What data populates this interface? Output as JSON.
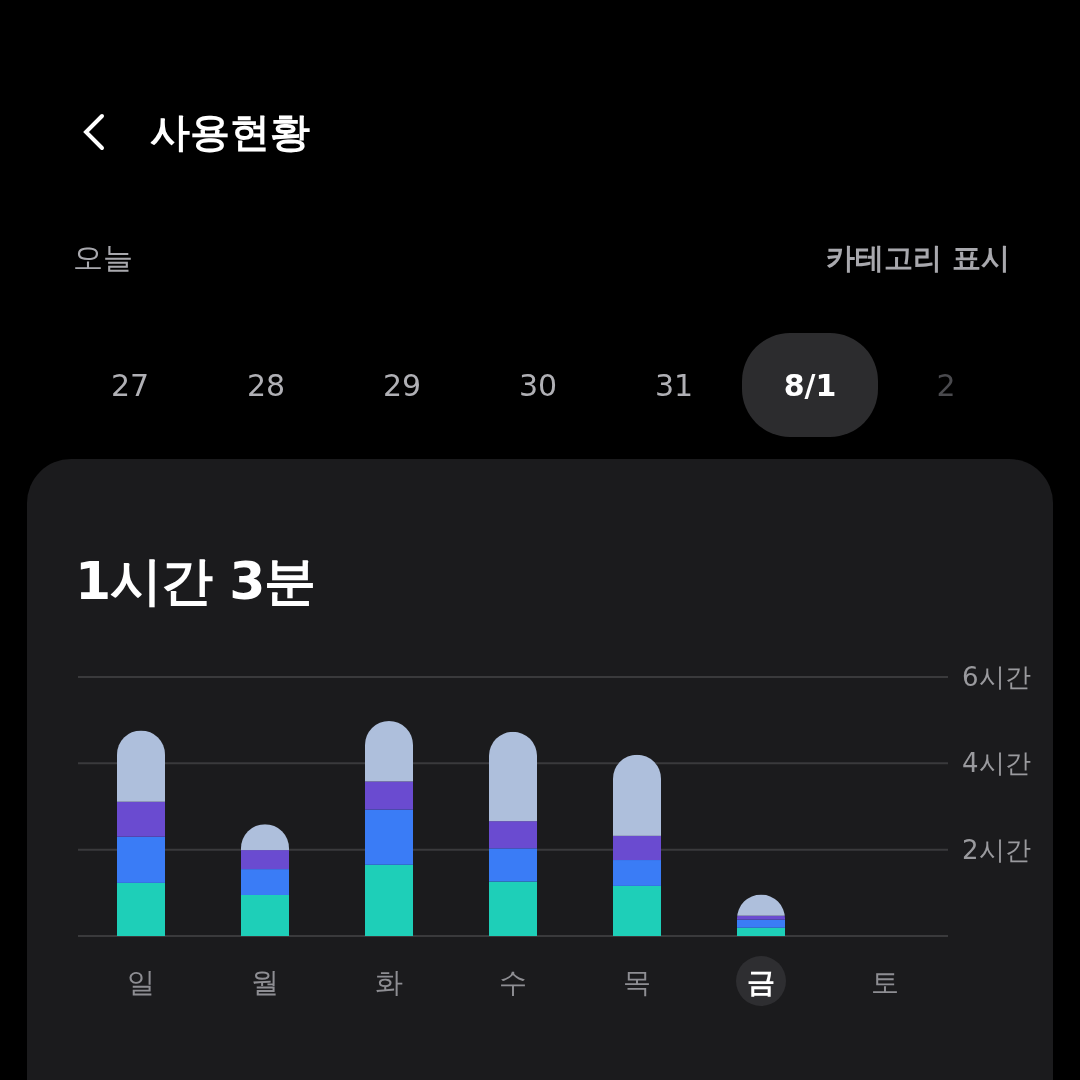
{
  "header": {
    "title": "사용현황"
  },
  "filter_row": {
    "period": "오늘",
    "category_toggle": "카테고리 표시"
  },
  "dates": [
    {
      "label": "27",
      "selected": false
    },
    {
      "label": "28",
      "selected": false
    },
    {
      "label": "29",
      "selected": false
    },
    {
      "label": "30",
      "selected": false
    },
    {
      "label": "31",
      "selected": false
    },
    {
      "label": "8/1",
      "selected": true
    },
    {
      "label": "2",
      "selected": false
    }
  ],
  "usage_card": {
    "total": "1시간 3분",
    "weekday_selected": [
      false,
      false,
      false,
      false,
      false,
      true,
      false
    ],
    "chart_data": {
      "type": "bar",
      "stacked": true,
      "categories": [
        "일",
        "월",
        "화",
        "수",
        "목",
        "금",
        "토"
      ],
      "ylim": [
        0,
        6
      ],
      "yticks": [
        {
          "value": 2,
          "label": "2시간"
        },
        {
          "value": 4,
          "label": "4시간"
        },
        {
          "value": 6,
          "label": "6시간"
        }
      ],
      "series": [
        {
          "color": "#1ecfb8",
          "values": [
            1.23,
            0.95,
            1.65,
            1.26,
            1.16,
            0.19,
            null
          ]
        },
        {
          "color": "#3a7cf6",
          "values": [
            1.07,
            0.6,
            1.28,
            0.77,
            0.6,
            0.19,
            null
          ]
        },
        {
          "color": "#6a4bd0",
          "values": [
            0.81,
            0.44,
            0.65,
            0.63,
            0.56,
            0.09,
            null
          ]
        },
        {
          "color": "#aebfdc",
          "values": [
            1.65,
            0.6,
            1.4,
            2.07,
            1.88,
            0.49,
            null
          ]
        }
      ]
    }
  }
}
